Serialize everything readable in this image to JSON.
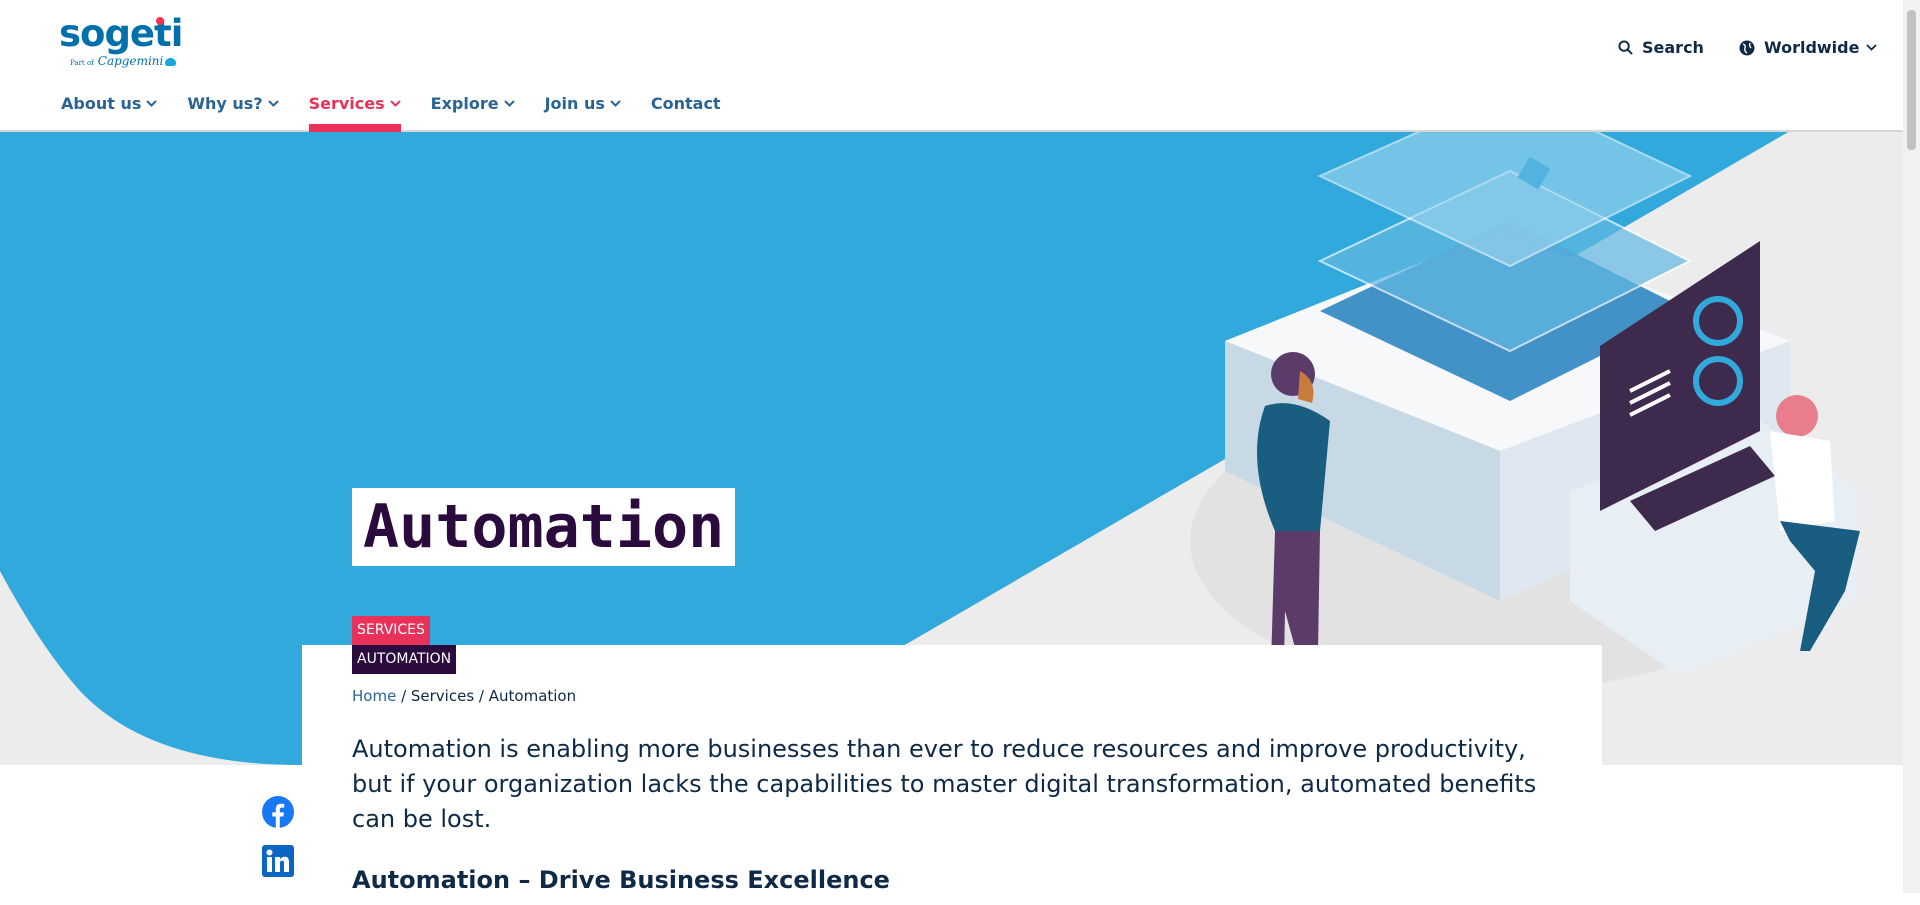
{
  "brand": {
    "logo_main": "sogeti",
    "logo_sub_prefix": "Part of",
    "logo_sub": "Capgemini"
  },
  "utility": {
    "search_label": "Search",
    "region_label": "Worldwide"
  },
  "nav": {
    "items": [
      {
        "label": "About us"
      },
      {
        "label": "Why us?"
      },
      {
        "label": "Services"
      },
      {
        "label": "Explore"
      },
      {
        "label": "Join us"
      },
      {
        "label": "Contact"
      }
    ],
    "active": "Services"
  },
  "hero": {
    "title": "Automation",
    "tags": [
      "SERVICES",
      "AUTOMATION"
    ]
  },
  "breadcrumb": {
    "home": "Home",
    "sep": " / ",
    "section": "Services",
    "current": "Automation"
  },
  "content": {
    "intro": "Automation is enabling more businesses than ever to reduce resources and improve productivity, but if your organization lacks the capabilities to master digital transformation, automated benefits can be lost.",
    "subhead": "Automation – Drive Business Excellence"
  },
  "colors": {
    "brand_blue": "#0070ad",
    "accent_red": "#e8325a",
    "hero_blue": "#32a9dc",
    "dark_purple": "#2b0a3d"
  },
  "icons": [
    "search-icon",
    "globe-icon",
    "chevron-down-icon",
    "facebook-icon",
    "linkedin-icon"
  ]
}
